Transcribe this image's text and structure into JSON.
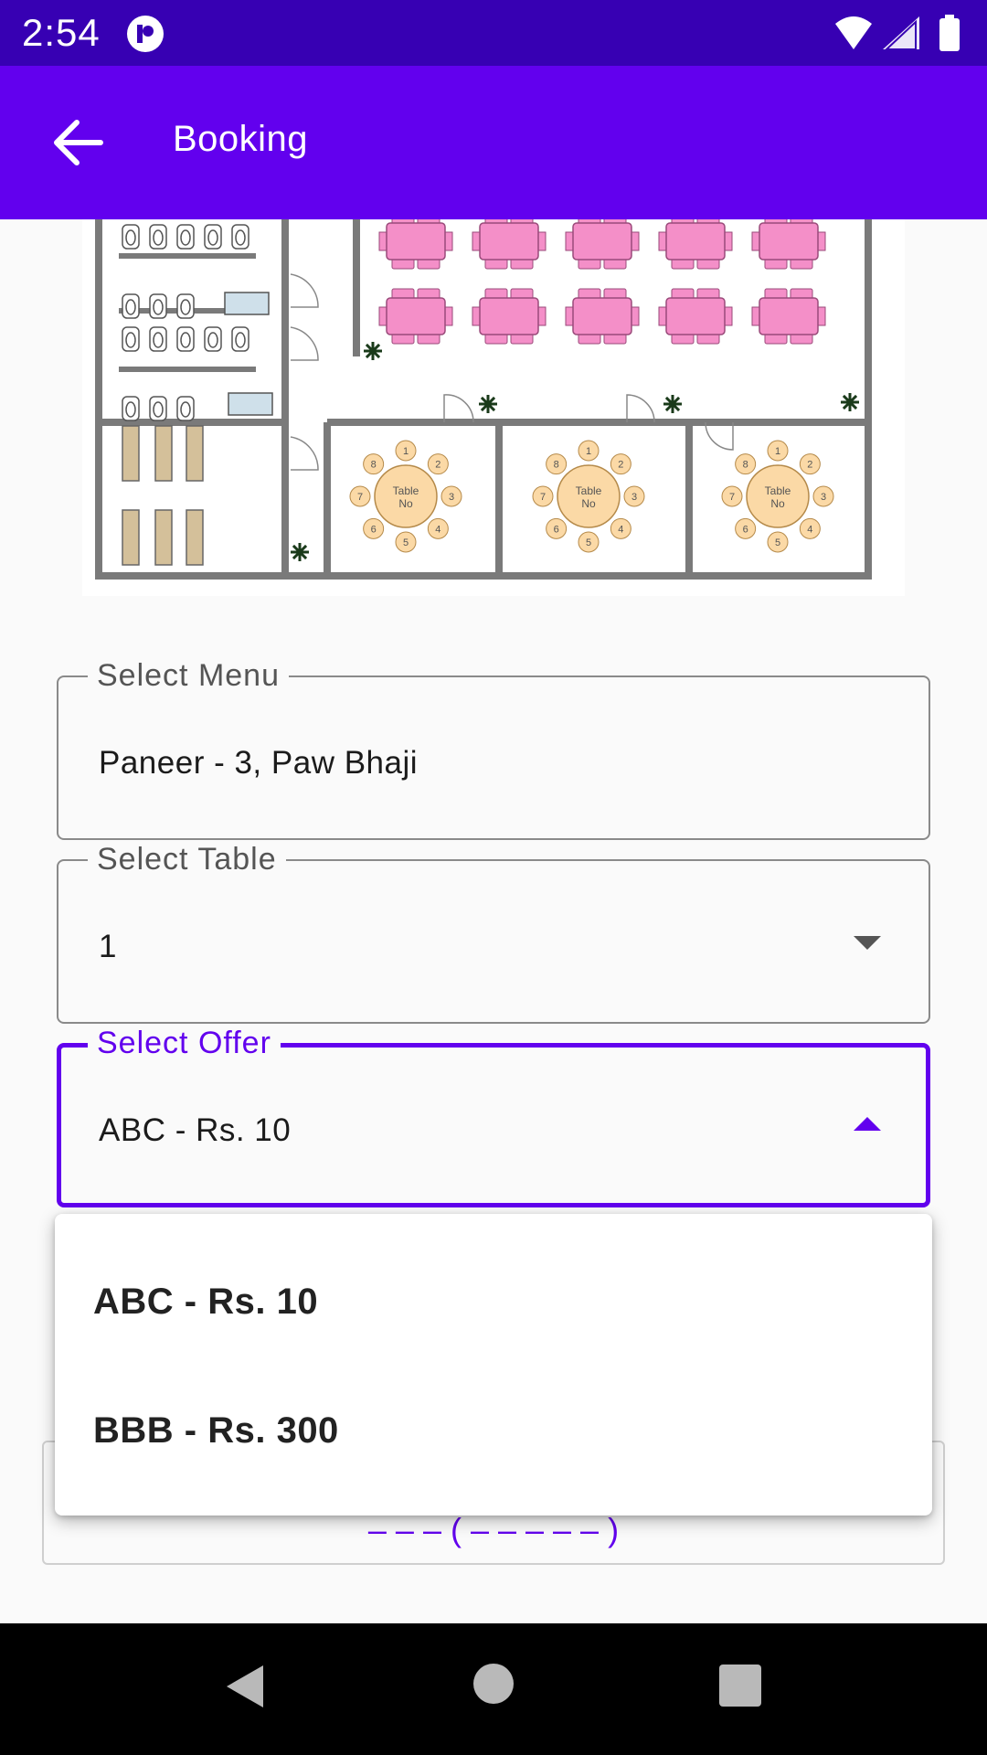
{
  "status_bar": {
    "time": "2:54"
  },
  "app_bar": {
    "title": "Booking"
  },
  "floor_plan": {
    "table_label_line1": "Table",
    "table_label_line2": "No",
    "seat_numbers": [
      "1",
      "2",
      "3",
      "4",
      "5",
      "6",
      "7",
      "8"
    ]
  },
  "form": {
    "menu": {
      "label": "Select Menu",
      "value": "Paneer - 3, Paw Bhaji"
    },
    "table": {
      "label": "Select Table",
      "value": "1"
    },
    "offer": {
      "label": "Select Offer",
      "value": "ABC - Rs. 10"
    }
  },
  "dropdown": {
    "options": [
      "ABC - Rs. 10",
      "BBB - Rs. 300"
    ]
  },
  "colors": {
    "primary": "#6200ee",
    "primary_dark": "#3700b3",
    "table_pink": "#f48fc8",
    "round_table": "#fbd9a6"
  }
}
